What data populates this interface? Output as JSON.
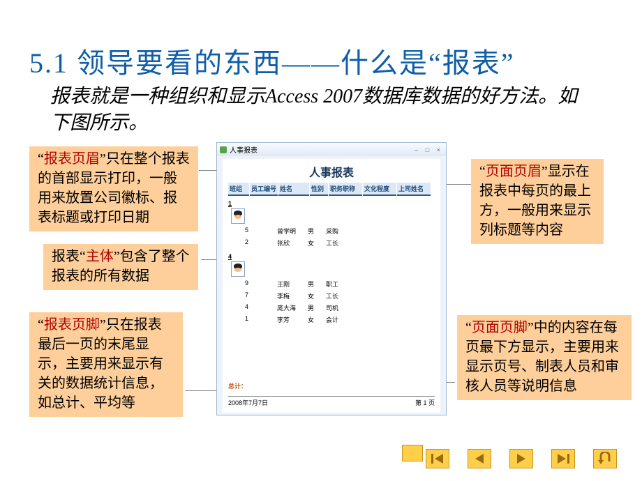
{
  "title": "5.1  领导要看的东西——什么是“报表”",
  "intro": "报表就是一种组织和显示Access 2007数据库数据的好方法。如下图所示。",
  "annot": {
    "a1": {
      "quote_open": "“",
      "term": "报表页眉",
      "quote_close": "”",
      "rest": "只在整个报表的首部显示打印，一般用来放置公司徽标、报表标题或打印日期"
    },
    "a2": {
      "pre": "报表",
      "quote_open": "“",
      "term": "主体",
      "quote_close": "”",
      "rest": "包含了整个报表的所有数据"
    },
    "a3": {
      "quote_open": "“",
      "term": "报表页脚",
      "quote_close": "”",
      "rest": "只在报表最后一页的末尾显示，主要用来显示有关的数据统计信息，如总计、平均等"
    },
    "a4": {
      "quote_open": "“",
      "term": "页面页眉",
      "quote_close": "”",
      "rest": "显示在报表中每页的最上方，一般用来显示列标题等内容"
    },
    "a5": {
      "quote_open": "“",
      "term": "页面页脚",
      "quote_close": "”",
      "rest": "中的内容在每页最下方显示，主要用来显示页号、制表人员和审核人员等说明信息"
    }
  },
  "report": {
    "window_title": "人事报表",
    "title": "人事报表",
    "columns": [
      "班组",
      "员工编号",
      "姓名",
      "性别",
      "职务职称",
      "文化程度",
      "上司姓名"
    ],
    "groups": [
      {
        "group_no": "1",
        "has_avatar": true,
        "rows": [
          {
            "id": "5",
            "name": "曾学明",
            "sex": "男",
            "job": "采购"
          },
          {
            "id": "2",
            "name": "张欣",
            "sex": "女",
            "job": "工长"
          }
        ]
      },
      {
        "group_no": "4",
        "has_avatar": true,
        "rows": [
          {
            "id": "9",
            "name": "王刚",
            "sex": "男",
            "job": "职工"
          },
          {
            "id": "7",
            "name": "李梅",
            "sex": "女",
            "job": "工长"
          },
          {
            "id": "4",
            "name": "庞大海",
            "sex": "男",
            "job": "司机"
          },
          {
            "id": "1",
            "name": "李芳",
            "sex": "女",
            "job": "会计"
          }
        ]
      }
    ],
    "summary_label": "总计：",
    "footer_date": "2008年7月7日",
    "footer_page": "第 1 页"
  },
  "nav": {
    "first": "first-button",
    "prev": "prev-button",
    "next": "next-button",
    "last": "last-button",
    "return": "return-button"
  }
}
